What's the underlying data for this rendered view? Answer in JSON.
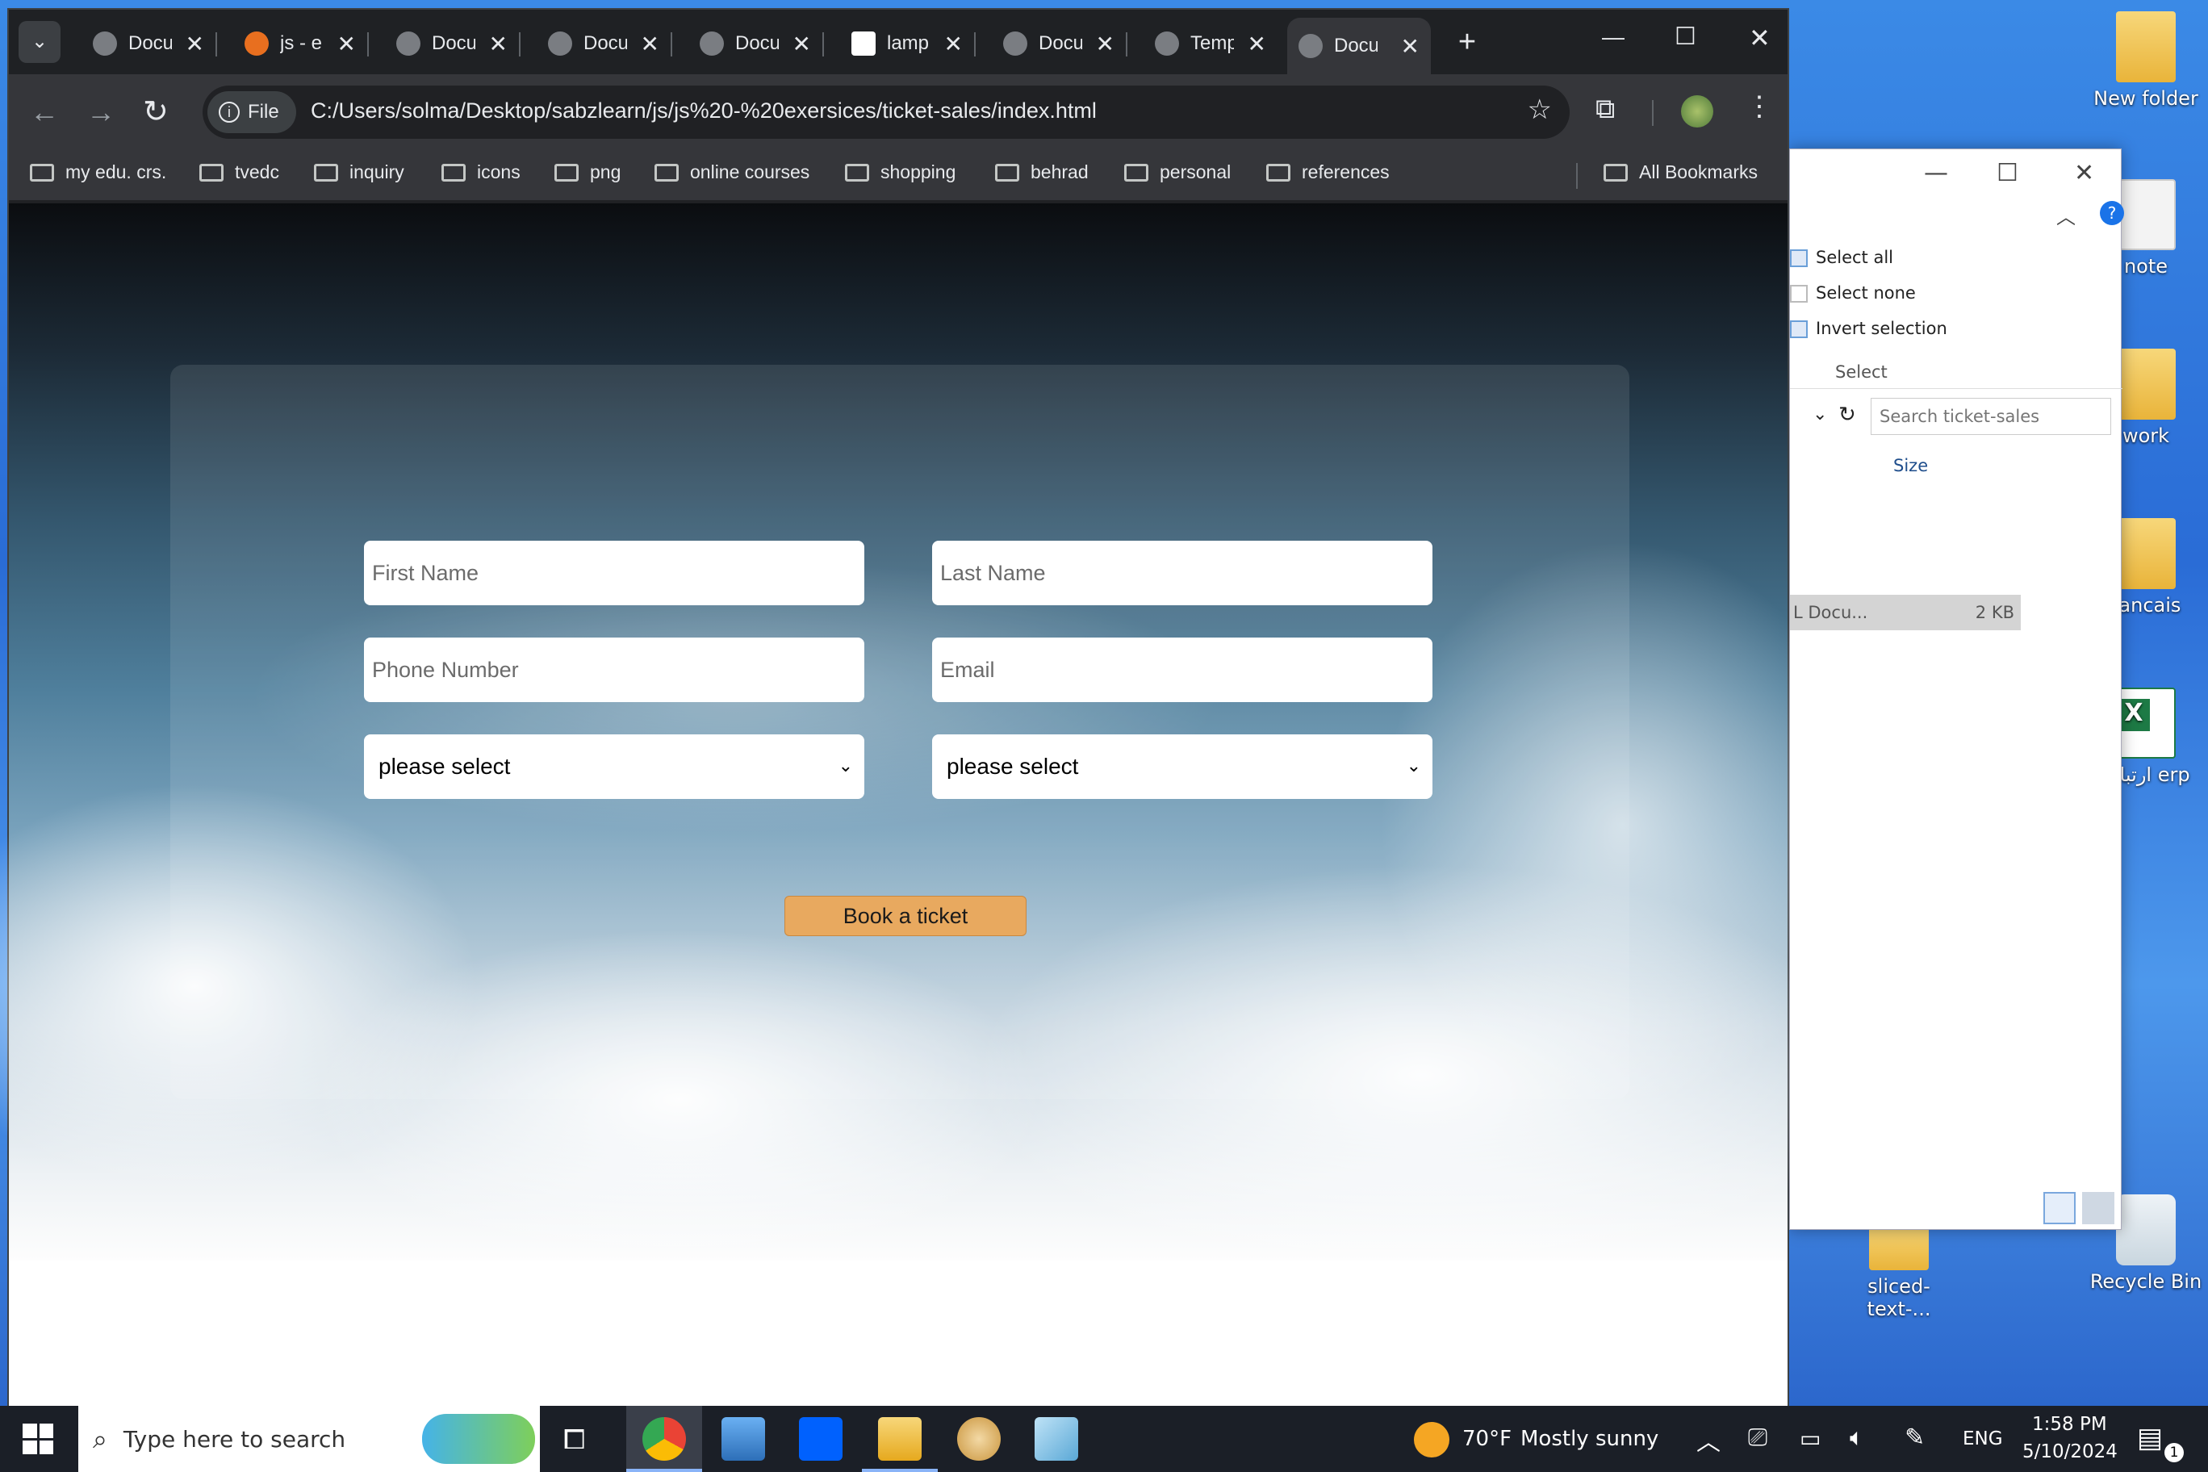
{
  "desktop": {
    "icons": [
      {
        "label": "New folder"
      },
      {
        "label": "note"
      },
      {
        "label": "work"
      },
      {
        "label": "rancais"
      },
      {
        "label": "ارتباط erp"
      },
      {
        "label": "sliced-text-..."
      },
      {
        "label": "Recycle Bin"
      }
    ]
  },
  "explorer": {
    "ribbon": {
      "select_all": "Select all",
      "select_none": "Select none",
      "invert_selection": "Invert selection",
      "group_label": "Select"
    },
    "search_placeholder": "Search ticket-sales",
    "column_size": "Size",
    "file_row": {
      "type": "L Docu...",
      "size": "2 KB"
    }
  },
  "browser": {
    "tabs": [
      {
        "title": "Docu"
      },
      {
        "title": "js - e"
      },
      {
        "title": "Docu"
      },
      {
        "title": "Docu"
      },
      {
        "title": "Docu"
      },
      {
        "title": "lamp"
      },
      {
        "title": "Docu"
      },
      {
        "title": "Temp"
      },
      {
        "title": "Docu"
      }
    ],
    "new_tab": "+",
    "address": {
      "scheme_label": "File",
      "url": "C:/Users/solma/Desktop/sabzlearn/js/js%20-%20exersices/ticket-sales/index.html"
    },
    "bookmarks": [
      "my edu. crs.",
      "tvedc",
      "inquiry",
      "icons",
      "png",
      "online courses",
      "shopping",
      "behrad",
      "personal",
      "references"
    ],
    "all_bookmarks": "All Bookmarks"
  },
  "form": {
    "first_name_placeholder": "First Name",
    "last_name_placeholder": "Last Name",
    "phone_placeholder": "Phone Number",
    "email_placeholder": "Email",
    "select_left": "please select",
    "select_right": "please select",
    "submit_label": "Book a ticket"
  },
  "taskbar": {
    "search_placeholder": "Type here to search",
    "weather": {
      "temp": "70°F",
      "condition": "Mostly sunny"
    },
    "language": "ENG",
    "time": "1:58 PM",
    "date": "5/10/2024",
    "notification_count": "1"
  }
}
